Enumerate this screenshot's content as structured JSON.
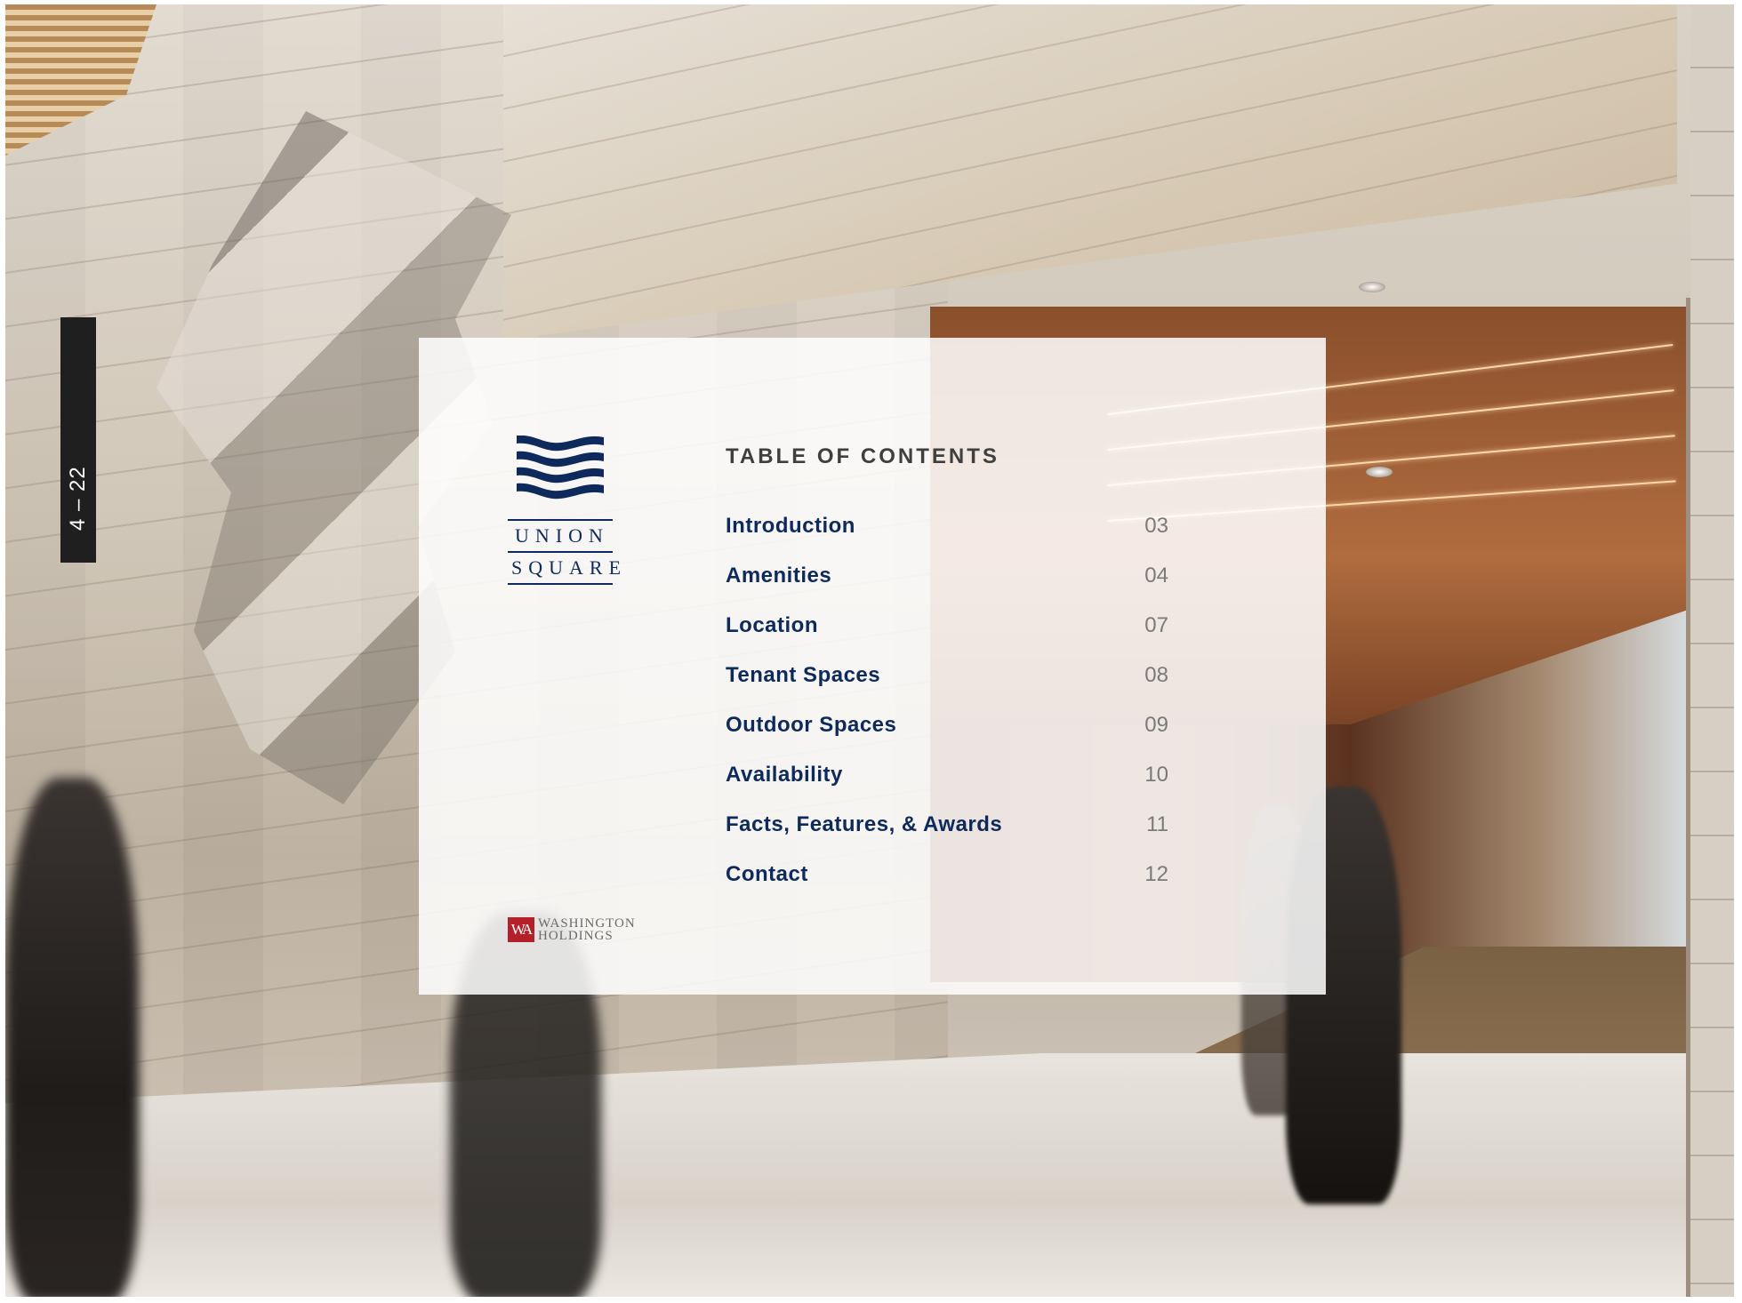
{
  "background": {
    "floor_sign": "4 – 22"
  },
  "brand": {
    "name_line1": "UNION",
    "name_line2": "SQUARE",
    "icon": "waves-icon",
    "color": "#0e2a5c"
  },
  "developer": {
    "mark": "WA",
    "line1": "WASHINGTON",
    "line2": "HOLDINGS",
    "color": "#b3202a"
  },
  "toc": {
    "title": "TABLE OF CONTENTS",
    "items": [
      {
        "label": "Introduction",
        "page": "03"
      },
      {
        "label": "Amenities",
        "page": "04"
      },
      {
        "label": "Location",
        "page": "07"
      },
      {
        "label": "Tenant Spaces",
        "page": "08"
      },
      {
        "label": "Outdoor Spaces",
        "page": "09"
      },
      {
        "label": "Availability",
        "page": "10"
      },
      {
        "label": "Facts, Features, & Awards",
        "page": "11"
      },
      {
        "label": "Contact",
        "page": "12"
      }
    ]
  }
}
